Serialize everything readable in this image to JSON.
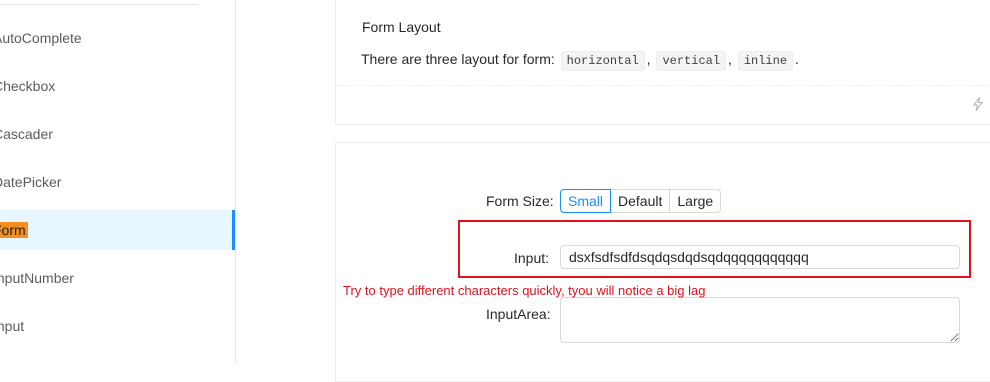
{
  "sidebar": {
    "items": [
      {
        "label": "AutoComplete",
        "selected": false
      },
      {
        "label": "Checkbox",
        "selected": false
      },
      {
        "label": "Cascader",
        "selected": false
      },
      {
        "label": "DatePicker",
        "selected": false
      },
      {
        "label": "Form",
        "selected": true
      },
      {
        "label": "InputNumber",
        "selected": false
      },
      {
        "label": "Input",
        "selected": false
      }
    ]
  },
  "demo_layout": {
    "title": "Form Layout",
    "description_prefix": "There are three layout for form: ",
    "codes": [
      "horizontal",
      "vertical",
      "inline"
    ],
    "separators": [
      ",",
      ",",
      "."
    ],
    "code_toggle_icon": "code-toggle-icon"
  },
  "demo_size": {
    "size_label": "Form Size:",
    "size_options": [
      "Small",
      "Default",
      "Large"
    ],
    "size_selected": "Small",
    "input_label": "Input:",
    "input_value": "dsxfsdfsdfdsqdqsdqdsqdqqqqqqqqqqq",
    "textarea_label": "InputArea:",
    "textarea_value": ""
  },
  "annotation": {
    "text": "Try to type different characters quickly, tyou will notice a big lag",
    "color": "#e0121e"
  },
  "colors": {
    "primary": "#1890ff",
    "selected_bg": "#e6f7ff",
    "highlight": "#f58e21"
  }
}
